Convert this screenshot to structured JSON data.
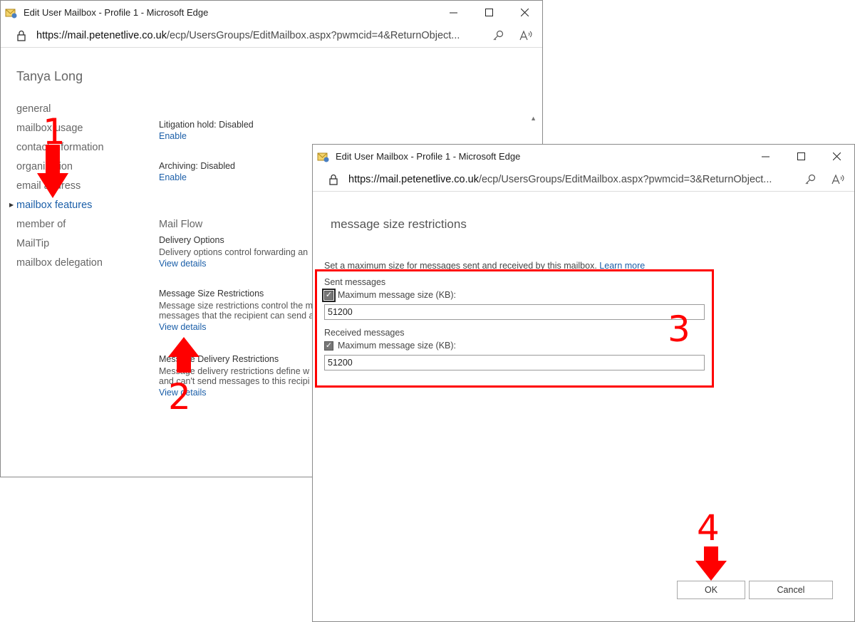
{
  "main_window": {
    "title": "Edit User Mailbox - Profile 1 - Microsoft Edge",
    "url_host": "https://mail.petenetlive.co.uk",
    "url_path": "/ecp/UsersGroups/EditMailbox.aspx?pwmcid=4&ReturnObject...",
    "user_name": "Tanya Long",
    "nav": [
      "general",
      "mailbox usage",
      "contact information",
      "organization",
      "email address",
      "mailbox features",
      "member of",
      "MailTip",
      "mailbox delegation"
    ],
    "active_nav": "mailbox features",
    "litigation": {
      "status": "Litigation hold: Disabled",
      "link": "Enable"
    },
    "archiving": {
      "status": "Archiving: Disabled",
      "link": "Enable"
    },
    "mail_flow": {
      "title": "Mail Flow",
      "delivery": {
        "heading": "Delivery Options",
        "desc": "Delivery options control forwarding an",
        "link": "View details"
      },
      "size": {
        "heading": "Message Size Restrictions",
        "desc1": "Message size restrictions control the m",
        "desc2": "messages that the recipient can send a",
        "link": "View details"
      },
      "delivery_restrictions": {
        "heading": "Message Delivery Restrictions",
        "desc1": "Message delivery restrictions define w",
        "desc2": "and can't send messages to this recipi",
        "link": "View details"
      }
    }
  },
  "dialog_window": {
    "title": "Edit User Mailbox - Profile 1 - Microsoft Edge",
    "url_host": "https://mail.petenetlive.co.uk",
    "url_path": "/ecp/UsersGroups/EditMailbox.aspx?pwmcid=3&ReturnObject...",
    "heading": "message size restrictions",
    "intro": "Set a maximum size for messages sent and received by this mailbox.",
    "learn_more": "Learn more",
    "sent": {
      "label": "Sent messages",
      "checkbox_label": "Maximum message size (KB):",
      "checked": true,
      "value": "51200"
    },
    "received": {
      "label": "Received messages",
      "checkbox_label": "Maximum message size (KB):",
      "checked": true,
      "value": "51200"
    },
    "ok_label": "OK",
    "cancel_label": "Cancel"
  },
  "annotations": {
    "step1": "1",
    "step2": "2",
    "step3": "3",
    "step4": "4",
    "color": "#ff0000"
  },
  "colors": {
    "link": "#1a5ea8",
    "annotation": "#ff0000"
  }
}
